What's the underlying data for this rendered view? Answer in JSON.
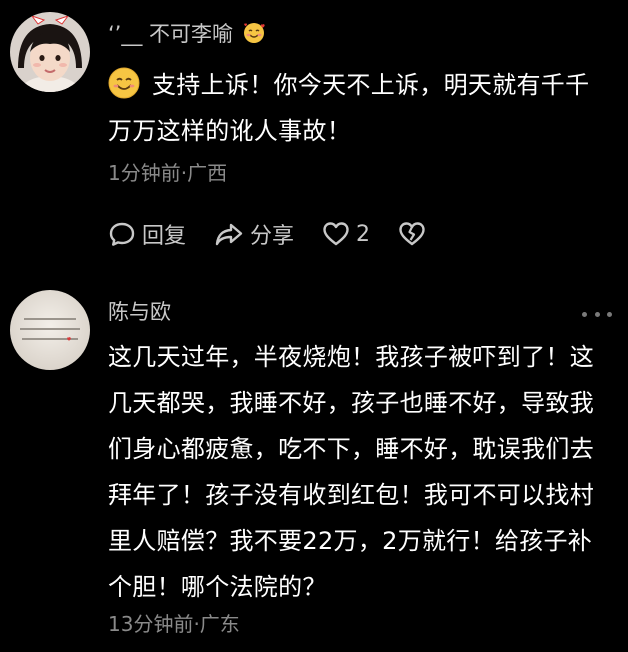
{
  "comments": [
    {
      "username": "‘’__ 不可李喻",
      "username_emoji": "smiling-face-with-hearts-icon",
      "text": "支持上诉！你今天不上诉，明天就有千千万万这样的讹人事故！",
      "text_emoji": "smiling-face-icon",
      "meta": "1分钟前·广西",
      "actions": {
        "reply_label": "回复",
        "share_label": "分享",
        "like_count": "2"
      }
    },
    {
      "username": "陈与欧",
      "text": "这几天过年，半夜烧炮！我孩子被吓到了！这几天都哭，我睡不好，孩子也睡不好，导致我们身心都疲惫，吃不下，睡不好，耽误我们去拜年了！孩子没有收到红包！我可不可以找村里人赔偿？我不要22万，2万就行！给孩子补个胆！哪个法院的？",
      "meta": "13分钟前·广东"
    }
  ],
  "colors": {
    "background": "#000000",
    "text": "#ffffff",
    "secondary": "#8a8a8a",
    "action": "#c8c8c8"
  }
}
